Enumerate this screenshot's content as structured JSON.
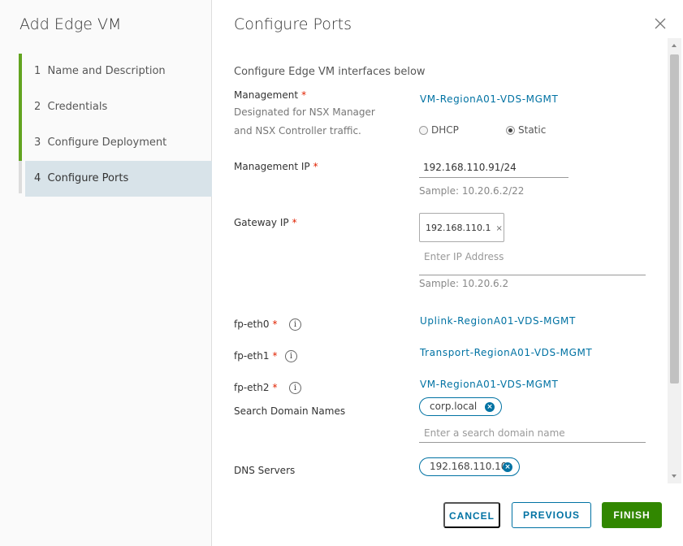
{
  "wizard": {
    "title": "Add Edge VM",
    "steps": [
      {
        "num": "1",
        "label": "Name and Description"
      },
      {
        "num": "2",
        "label": "Credentials"
      },
      {
        "num": "3",
        "label": "Configure Deployment"
      },
      {
        "num": "4",
        "label": "Configure Ports"
      }
    ],
    "current_step": 4
  },
  "page": {
    "title": "Configure Ports",
    "intro": "Configure Edge VM interfaces below"
  },
  "management": {
    "label": "Management",
    "required": "*",
    "description_line1": "Designated for NSX Manager",
    "description_line2": "and NSX Controller traffic.",
    "network": "VM-RegionA01-VDS-MGMT",
    "radio_dhcp": "DHCP",
    "radio_static": "Static",
    "selected": "Static"
  },
  "management_ip": {
    "label": "Management IP",
    "required": "*",
    "value": "192.168.110.91/24",
    "sample": "Sample: 10.20.6.2/22"
  },
  "gateway_ip": {
    "label": "Gateway IP",
    "required": "*",
    "chip": "192.168.110.1",
    "chip_remove": "×",
    "placeholder": "Enter IP Address",
    "sample": "Sample: 10.20.6.2"
  },
  "fp_eth0": {
    "label": "fp-eth0",
    "required": "*",
    "info": "i",
    "network": "Uplink-RegionA01-VDS-MGMT"
  },
  "fp_eth1": {
    "label": "fp-eth1",
    "required": "*",
    "info": "i",
    "network": "Transport-RegionA01-VDS-MGMT"
  },
  "fp_eth2": {
    "label": "fp-eth2",
    "required": "*",
    "info": "i",
    "network": "VM-RegionA01-VDS-MGMT"
  },
  "search_domains": {
    "label": "Search Domain Names",
    "chip": "corp.local",
    "placeholder": "Enter a search domain name"
  },
  "dns_servers": {
    "label": "DNS Servers",
    "chip": "192.168.110.10"
  },
  "buttons": {
    "cancel": "CANCEL",
    "previous": "PREVIOUS",
    "finish": "FINISH"
  },
  "colors": {
    "accent": "#0072a3",
    "complete": "#62a420",
    "finish": "#318700",
    "required": "#e12200"
  }
}
